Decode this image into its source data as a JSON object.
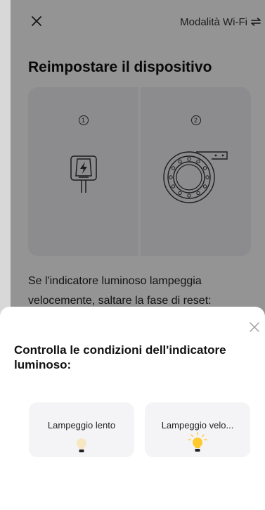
{
  "header": {
    "close_icon": "close-icon",
    "wifi_mode_label": "Modalità Wi-Fi",
    "switch_icon": "swap-arrows-icon"
  },
  "page": {
    "title": "Reimpostare il dispositivo",
    "steps": [
      {
        "number": "1",
        "icon": "power-plug-icon"
      },
      {
        "number": "2",
        "icon": "device-indicator-ring-icon"
      }
    ],
    "description": "Se l'indicatore luminoso lampeggia velocemente, saltare la fase di reset:"
  },
  "sheet": {
    "close_icon": "close-icon",
    "title": "Controlla le condizioni dell'indicatore luminoso:",
    "options": [
      {
        "label": "Lampeggio lento",
        "icon": "bulb-dim-icon"
      },
      {
        "label": "Lampeggio velo...",
        "icon": "bulb-bright-icon"
      }
    ]
  },
  "colors": {
    "overlay": "#000000",
    "card": "#f2f2f4",
    "bulb_dim": "#f7e6c2",
    "bulb_bright": "#ffc92e"
  }
}
